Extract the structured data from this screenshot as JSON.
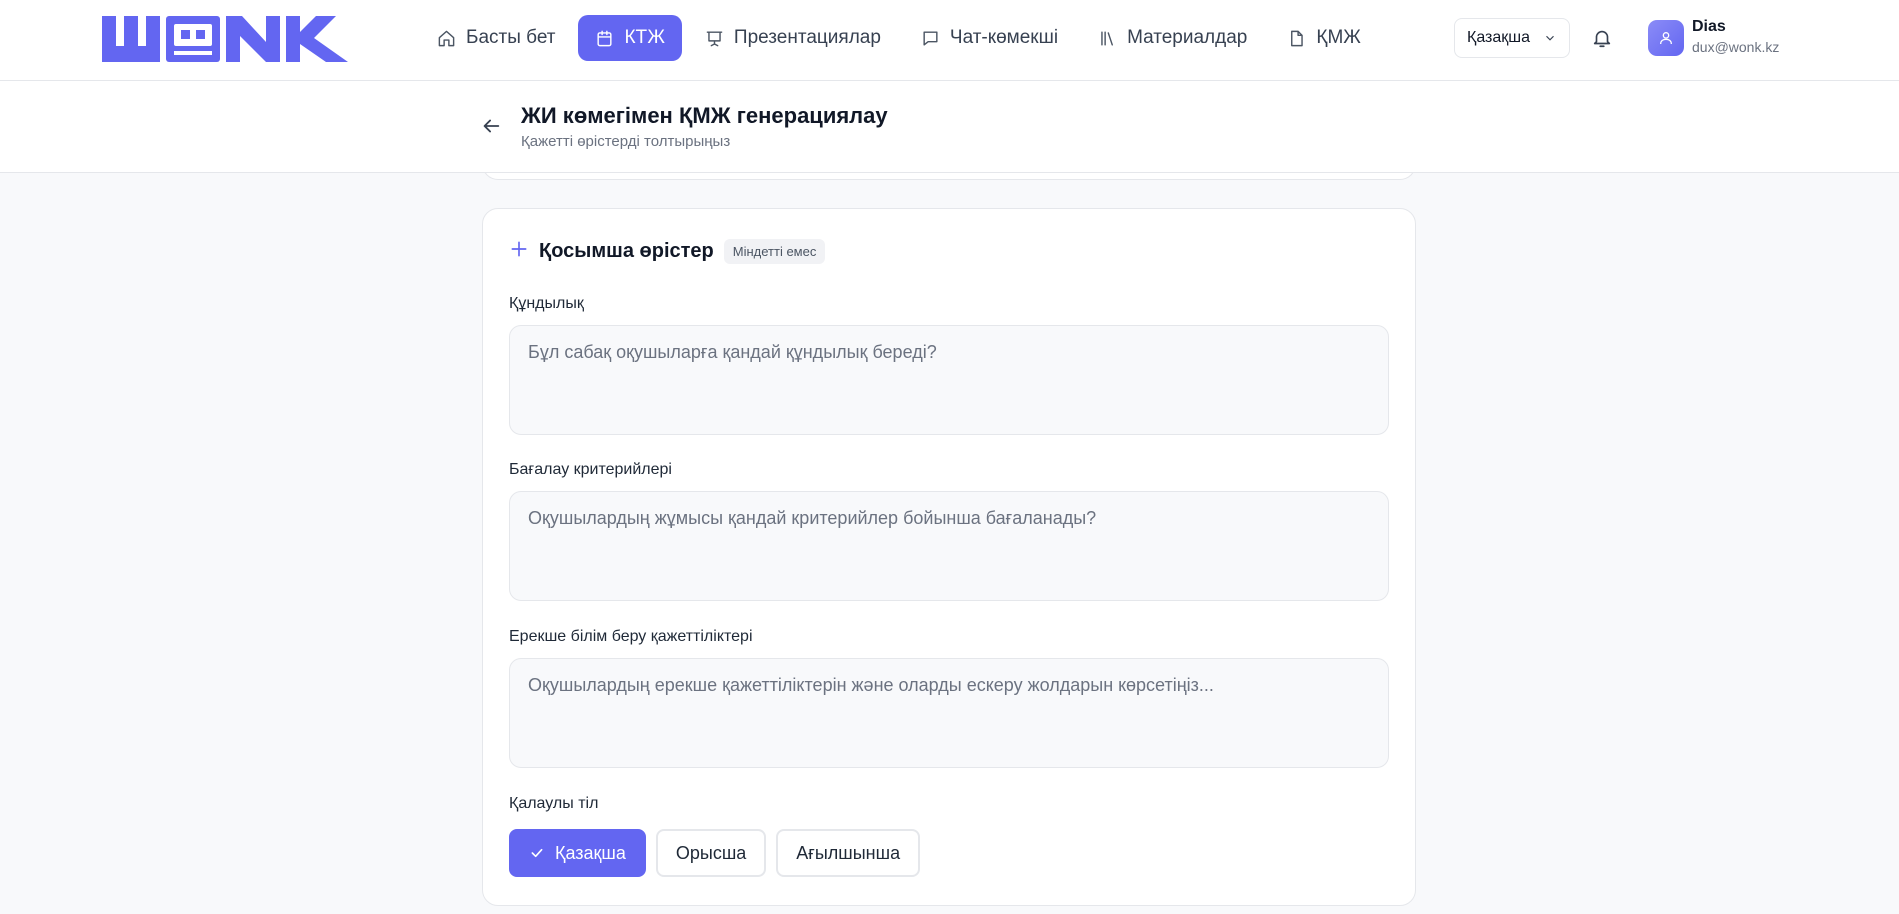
{
  "nav": {
    "items": [
      {
        "label": "Басты бет",
        "icon": "home-icon",
        "active": false
      },
      {
        "label": "КТЖ",
        "icon": "calendar-icon",
        "active": true
      },
      {
        "label": "Презентациялар",
        "icon": "presentation-icon",
        "active": false
      },
      {
        "label": "Чат-көмекші",
        "icon": "chat-icon",
        "active": false
      },
      {
        "label": "Материалдар",
        "icon": "library-icon",
        "active": false
      },
      {
        "label": "ҚМЖ",
        "icon": "file-icon",
        "active": false
      }
    ]
  },
  "header": {
    "language": "Қазақша",
    "user_name": "Dias",
    "user_email": "dux@wonk.kz"
  },
  "page": {
    "title": "ЖИ көмегімен ҚМЖ генерациялау",
    "subtitle": "Қажетті өрістерді толтырыңыз"
  },
  "card": {
    "title": "Қосымша өрістер",
    "badge": "Міндетті емес",
    "fields": [
      {
        "label": "Құндылық",
        "placeholder": "Бұл сабақ оқушыларға қандай құндылық береді?"
      },
      {
        "label": "Бағалау критерийлері",
        "placeholder": "Оқушылардың жұмысы қандай критерийлер бойынша бағаланады?"
      },
      {
        "label": "Ерекше білім беру қажеттіліктері",
        "placeholder": "Оқушылардың ерекше қажеттіліктерін және оларды ескеру жолдарын көрсетіңіз..."
      }
    ],
    "language_label": "Қалаулы тіл",
    "language_options": [
      "Қазақша",
      "Орысша",
      "Ағылшынша"
    ],
    "selected_language": "Қазақша"
  },
  "colors": {
    "accent": "#6366f1",
    "background": "#f8f9fb",
    "border": "#e5e7eb"
  }
}
